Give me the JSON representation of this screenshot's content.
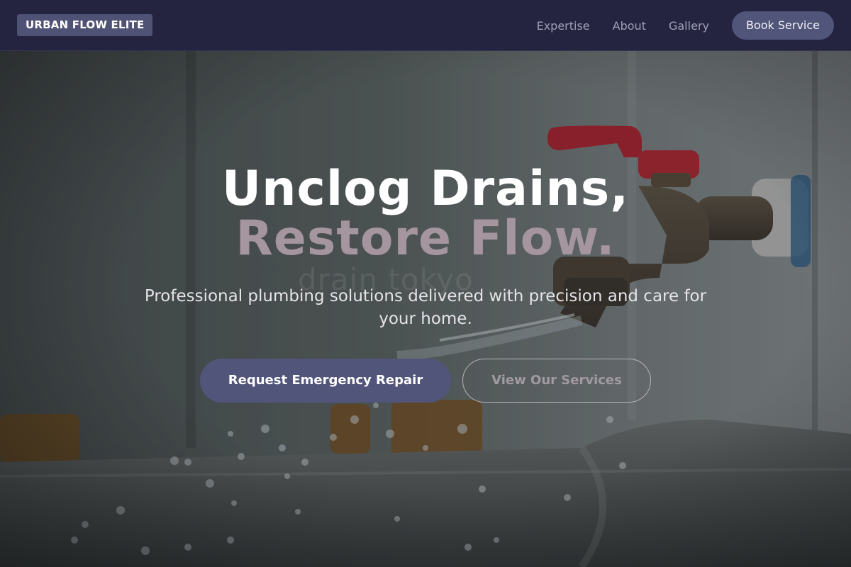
{
  "header": {
    "logo_text": "URBAN FLOW ELITE",
    "nav": [
      {
        "label": "Expertise"
      },
      {
        "label": "About"
      },
      {
        "label": "Gallery"
      }
    ],
    "cta_label": "Book Service"
  },
  "hero": {
    "headline_line1": "Unclog Drains,",
    "headline_line2": "Restore Flow.",
    "subheadline": "Professional plumbing solutions delivered with precision and care for your home.",
    "primary_button": "Request Emergency Repair",
    "secondary_button": "View Our Services",
    "background_watermark": "drain tokyo",
    "background_image": "dripping-faucet-photo"
  },
  "colors": {
    "nav_background": "#242440",
    "accent": "#52557a",
    "headline_accent": "#a5959f"
  }
}
